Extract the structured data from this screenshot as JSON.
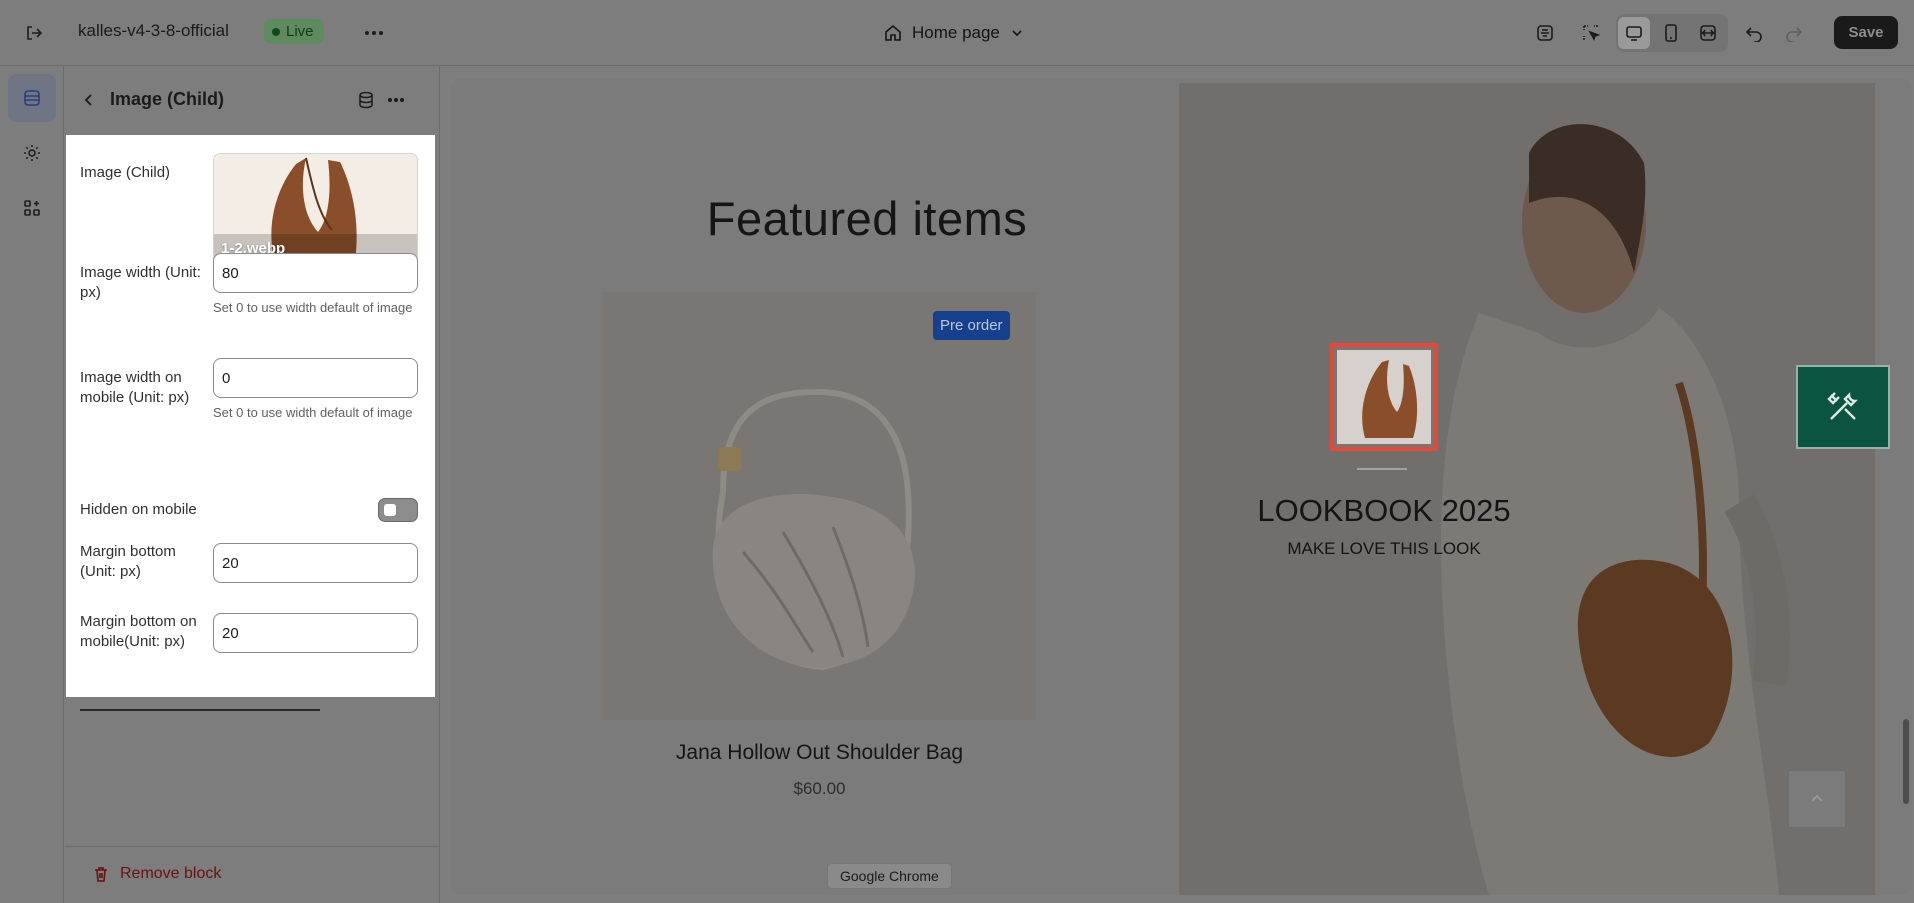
{
  "topbar": {
    "store_name": "kalles-v4-3-8-official",
    "live_label": "Live",
    "page_select": "Home page",
    "save_label": "Save"
  },
  "panel": {
    "title": "Image (Child)",
    "fields": {
      "image_label": "Image (Child)",
      "image_filename": "1-2.webp",
      "width_label": "Image width (Unit: px)",
      "width_value": "80",
      "width_hint": "Set 0 to use width default of image",
      "mobile_width_label": "Image width on mobile (Unit: px)",
      "mobile_width_value": "0",
      "mobile_width_hint": "Set 0 to use width default of image",
      "hidden_mobile_label": "Hidden on mobile",
      "hidden_mobile_checked": false,
      "margin_bottom_label": "Margin bottom (Unit: px)",
      "margin_bottom_value": "20",
      "margin_bottom_mobile_label": "Margin bottom on mobile(Unit: px)",
      "margin_bottom_mobile_value": "20"
    },
    "remove_label": "Remove block"
  },
  "preview": {
    "featured_title": "Featured items",
    "product": {
      "badge": "Pre order",
      "name": "Jana Hollow Out Shoulder Bag",
      "price": "$60.00"
    },
    "lookbook": {
      "title": "LOOKBOOK 2025",
      "subtitle": "MAKE LOVE THIS LOOK"
    }
  },
  "tooltip": "Google Chrome",
  "colors": {
    "overlay_gray": "#7d7d7d",
    "selection_red": "#e04a3a",
    "fab_green": "#0b5441",
    "badge_blue": "#163f8c",
    "remove_red": "#6a1010"
  },
  "icons": [
    "exit-icon",
    "more-icon",
    "home-icon",
    "chevron-down-icon",
    "inspector-icon",
    "select-element-icon",
    "desktop-icon",
    "mobile-icon",
    "fullwidth-icon",
    "undo-icon",
    "redo-icon",
    "sections-icon",
    "settings-gear-icon",
    "apps-icon",
    "back-arrow-icon",
    "database-icon",
    "trash-icon",
    "tools-icon",
    "chevron-up-icon"
  ]
}
